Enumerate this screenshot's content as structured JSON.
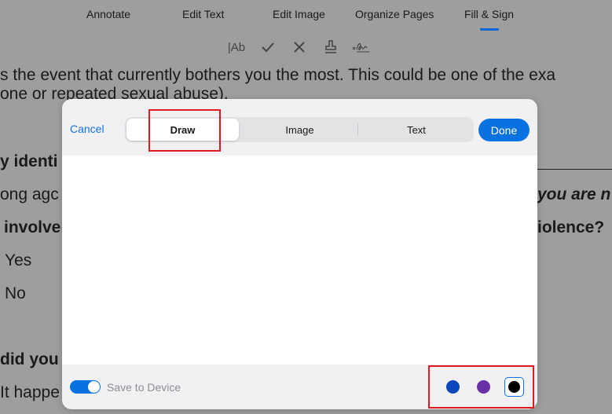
{
  "toolbar": {
    "tabs": [
      "Annotate",
      "Edit Text",
      "Edit Image",
      "Organize Pages",
      "Fill & Sign"
    ],
    "active_tab": "Fill & Sign",
    "tools": [
      "text-field-icon",
      "checkmark-icon",
      "cross-icon",
      "stamp-icon",
      "signature-icon"
    ],
    "text_tool_label": "|Ab"
  },
  "document": {
    "lines": [
      "s the event that currently bothers you the most. This could be one of the exa",
      "one or repeated sexual abuse).",
      "y identi",
      "ong agc",
      "you are n",
      "involve",
      "iolence?",
      "Yes",
      "No",
      "did you",
      "It happe"
    ]
  },
  "modal": {
    "cancel_label": "Cancel",
    "segments": [
      "Draw",
      "Image",
      "Text"
    ],
    "active_segment": "Draw",
    "done_label": "Done",
    "save_to_device_label": "Save to Device",
    "save_to_device_on": true,
    "ink_colors": [
      {
        "name": "blue",
        "hex": "#0a47b8"
      },
      {
        "name": "purple",
        "hex": "#6a30a8"
      },
      {
        "name": "black",
        "hex": "#000000"
      }
    ],
    "selected_color": "black"
  },
  "colors": {
    "accent": "#0a72e0",
    "highlight": "#e0191f",
    "overlay": "#9e9e9e"
  }
}
